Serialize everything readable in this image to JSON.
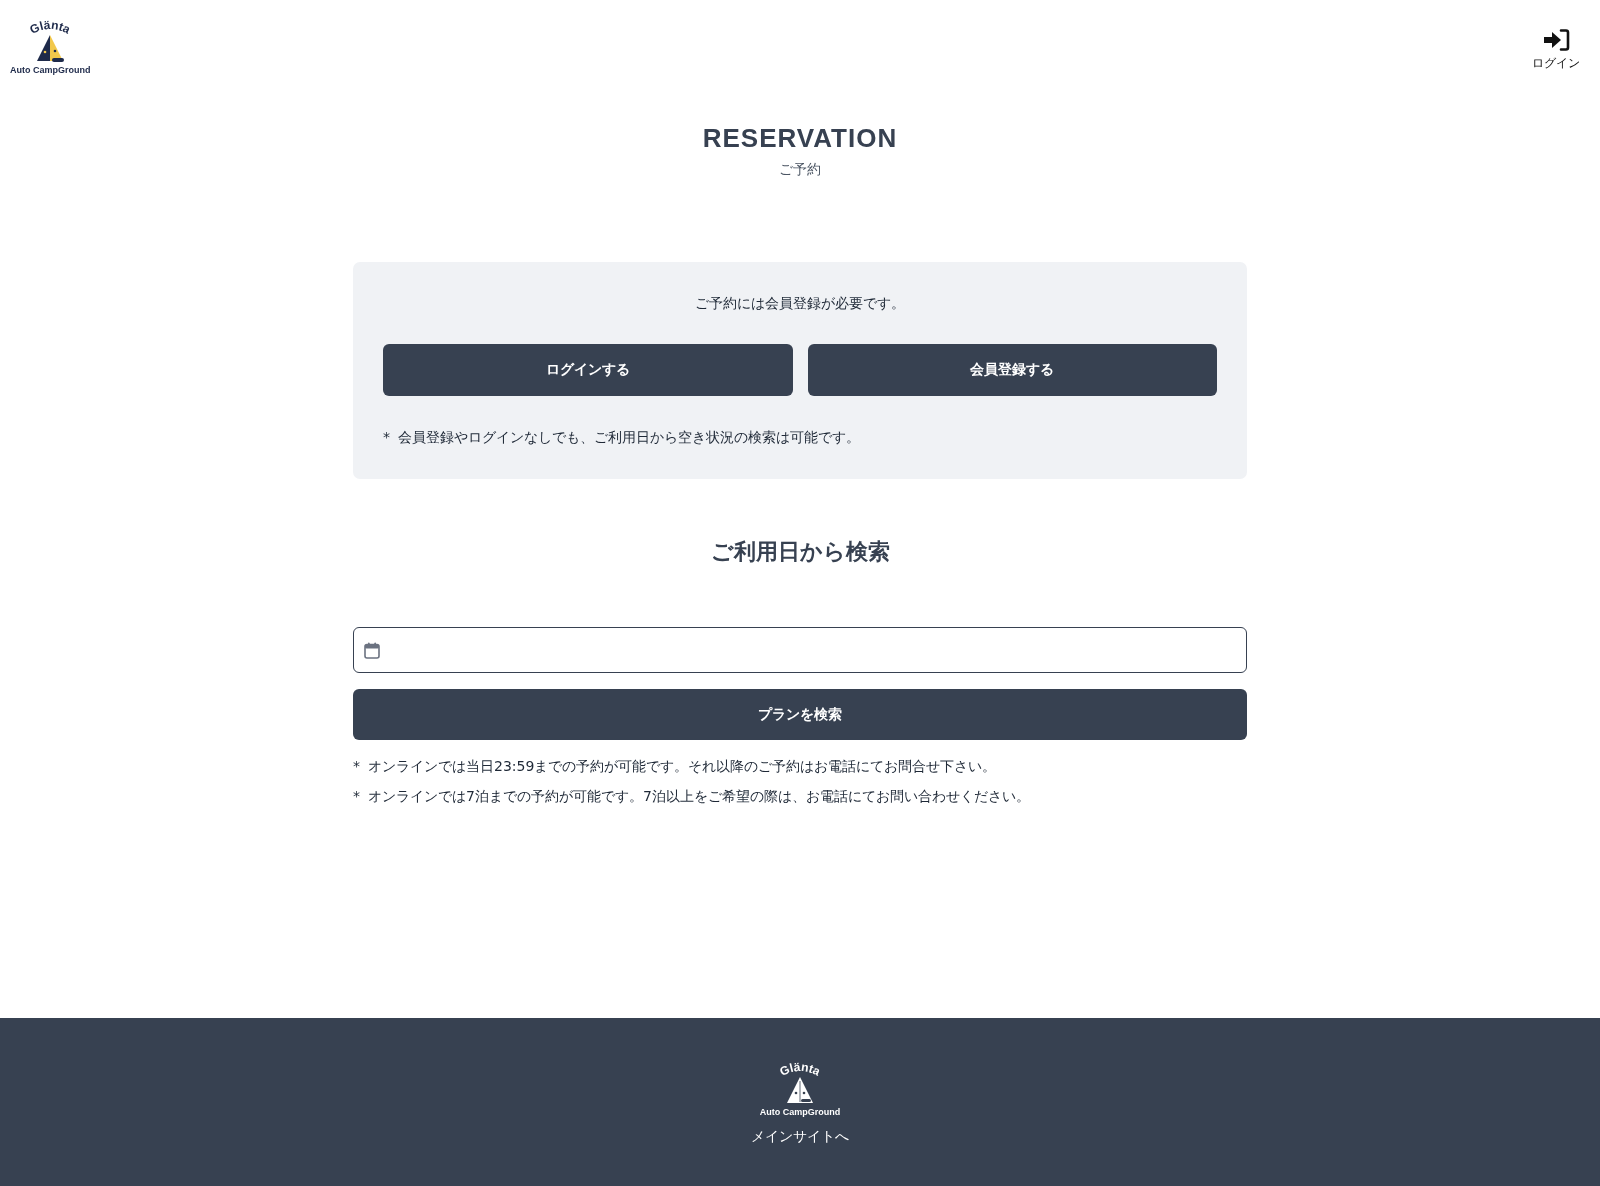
{
  "header": {
    "logo": {
      "wordmark": "Glänta",
      "tagline": "Auto CampGround"
    },
    "login_link": {
      "label": "ログイン"
    }
  },
  "page_title": {
    "title": "RESERVATION",
    "subtitle": "ご予約"
  },
  "membership_panel": {
    "message": "ご予約には会員登録が必要です。",
    "buttons": [
      {
        "label": "ログインする"
      },
      {
        "label": "会員登録する"
      }
    ],
    "note": {
      "marker": "*",
      "text": "会員登録やログインなしでも、ご利用日から空き状況の検索は可能です。"
    }
  },
  "date_search": {
    "heading": "ご利用日から検索",
    "search_button": {
      "label": "プランを検索"
    },
    "notes": [
      {
        "marker": "*",
        "text": "オンラインでは当日23:59までの予約が可能です。それ以降のご予約はお電話にてお問合せ下さい。"
      },
      {
        "marker": "*",
        "text": "オンラインでは7泊までの予約が可能です。7泊以上をご希望の際は、お電話にてお問い合わせください。"
      }
    ]
  },
  "footer": {
    "logo": {
      "wordmark": "Glänta",
      "tagline": "Auto CampGround"
    },
    "main_site_link": {
      "label": "メインサイトへ"
    }
  }
}
